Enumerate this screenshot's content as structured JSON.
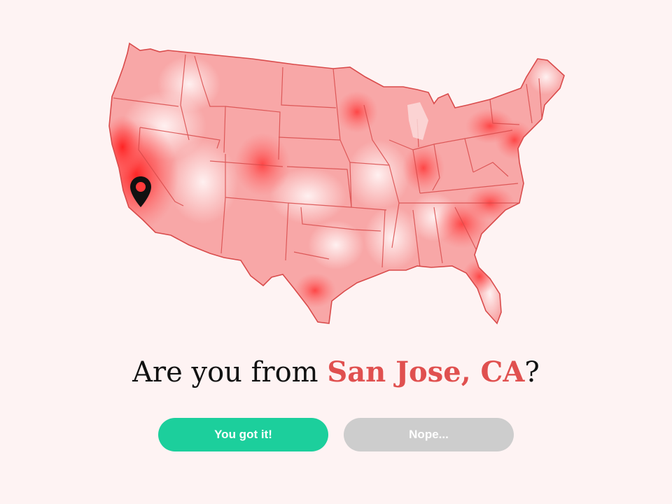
{
  "question": {
    "prefix": "Are you from ",
    "city": "San Jose, CA",
    "suffix": "?"
  },
  "buttons": {
    "yes_label": "You got it!",
    "no_label": "Nope..."
  },
  "map": {
    "icons": [
      "us-map",
      "location-pin-icon"
    ],
    "colors": {
      "base": "#f59a9a",
      "hot": "#ff2d2d",
      "border": "#d94b4b",
      "pin": "#111111"
    }
  },
  "colors": {
    "background": "#fef3f3",
    "accent": "#e0504f",
    "yes_button": "#1ccf9c",
    "no_button": "#cdcdcd"
  }
}
